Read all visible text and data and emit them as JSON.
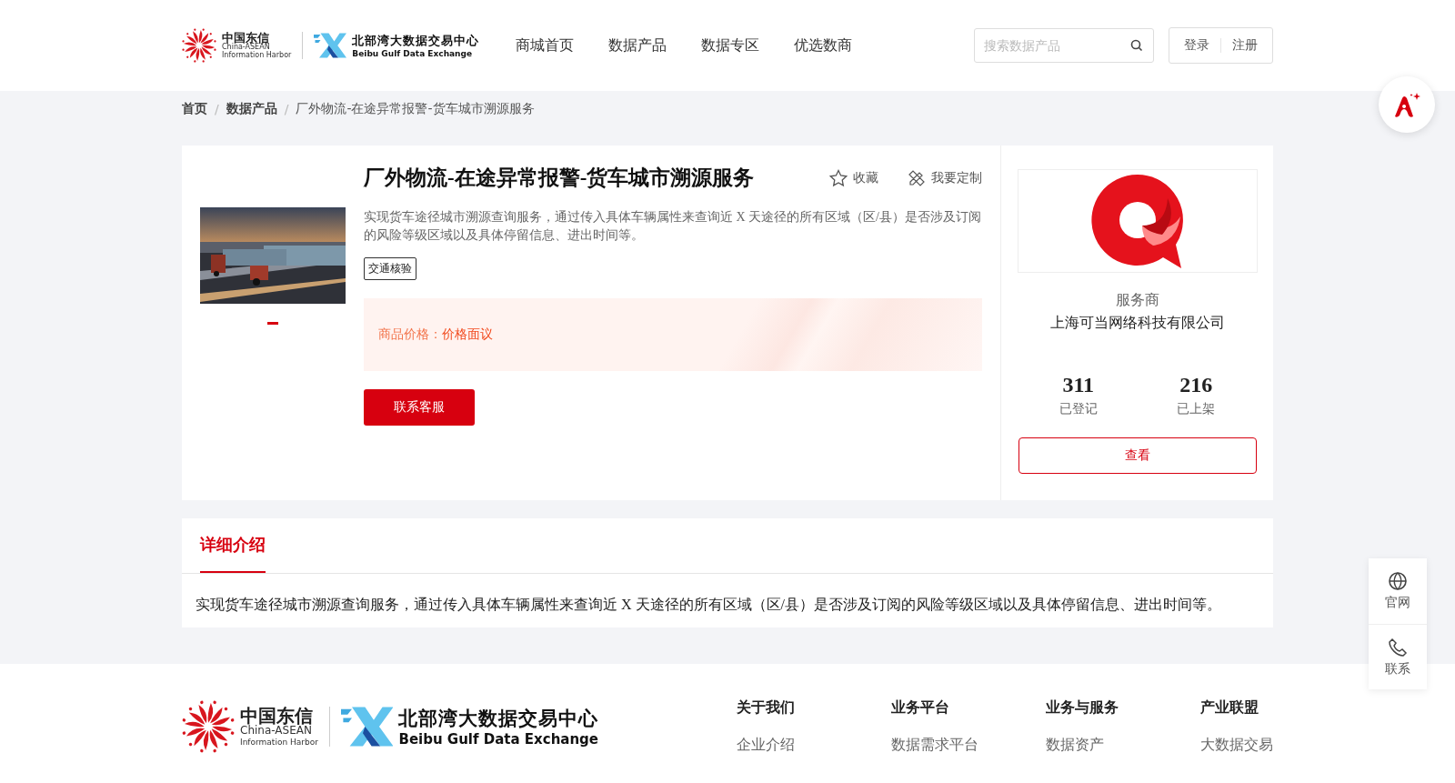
{
  "header": {
    "logo": {
      "cn": "中国东信",
      "en1": "China-ASEAN",
      "en2": "Information Harbor",
      "name_cn": "北部湾大数据交易中心",
      "name_en": "Beibu Gulf Data Exchange"
    },
    "nav": [
      {
        "label": "商城首页",
        "selected": false
      },
      {
        "label": "数据产品",
        "selected": false
      },
      {
        "label": "数据专区",
        "selected": false
      },
      {
        "label": "优选数商",
        "selected": false
      }
    ],
    "search": {
      "placeholder": "搜索数据产品"
    },
    "login": "登录",
    "register": "注册"
  },
  "breadcrumb": [
    {
      "kind": "link",
      "text": "首页"
    },
    {
      "kind": "sep",
      "text": "/"
    },
    {
      "kind": "link",
      "text": "数据产品"
    },
    {
      "kind": "sep",
      "text": "/"
    },
    {
      "kind": "current",
      "text": "厂外物流-在途异常报警-货车城市溯源服务"
    }
  ],
  "product": {
    "title": "厂外物流-在途异常报警-货车城市溯源服务",
    "favorite": "收藏",
    "customize": "我要定制",
    "description": "实现货车途径城市溯源查询服务，通过传入具体车辆属性来查询近 X 天途径的所有区域（区/县）是否涉及订阅的风险等级区域以及具体停留信息、进出时间等。",
    "tags": [
      "交通核验"
    ],
    "price_label": "商品价格：",
    "price": "价格面议",
    "contact": "联系客服",
    "gallery": [
      {
        "kind": "picture",
        "selected": true
      }
    ]
  },
  "provider": {
    "label": "服务商",
    "name": "上海可当网络科技有限公司",
    "stats": [
      {
        "value": "311",
        "label": "已登记"
      },
      {
        "value": "216",
        "label": "已上架"
      }
    ],
    "view": "查看"
  },
  "detail": {
    "tabs": [
      {
        "label": "详细介绍",
        "selected": true
      }
    ],
    "text": "实现货车途径城市溯源查询服务，通过传入具体车辆属性来查询近 X 天途径的所有区域（区/县）是否涉及订阅的风险等级区域以及具体停留信息、进出时间等。"
  },
  "side_panel": [
    {
      "kind": "globe",
      "label": "官网"
    },
    {
      "kind": "phone",
      "label": "联系"
    }
  ],
  "footer": {
    "logo": {
      "cn": "中国东信",
      "en1": "China-ASEAN",
      "en2": "Information Harbor",
      "name_cn": "北部湾大数据交易中心",
      "name_en": "Beibu Gulf Data Exchange"
    },
    "columns": [
      {
        "title": "关于我们",
        "links": [
          "企业介绍"
        ]
      },
      {
        "title": "业务平台",
        "links": [
          "数据需求平台"
        ]
      },
      {
        "title": "业务与服务",
        "links": [
          "数据资产"
        ]
      },
      {
        "title": "产业联盟",
        "links": [
          "大数据交易"
        ]
      }
    ]
  }
}
